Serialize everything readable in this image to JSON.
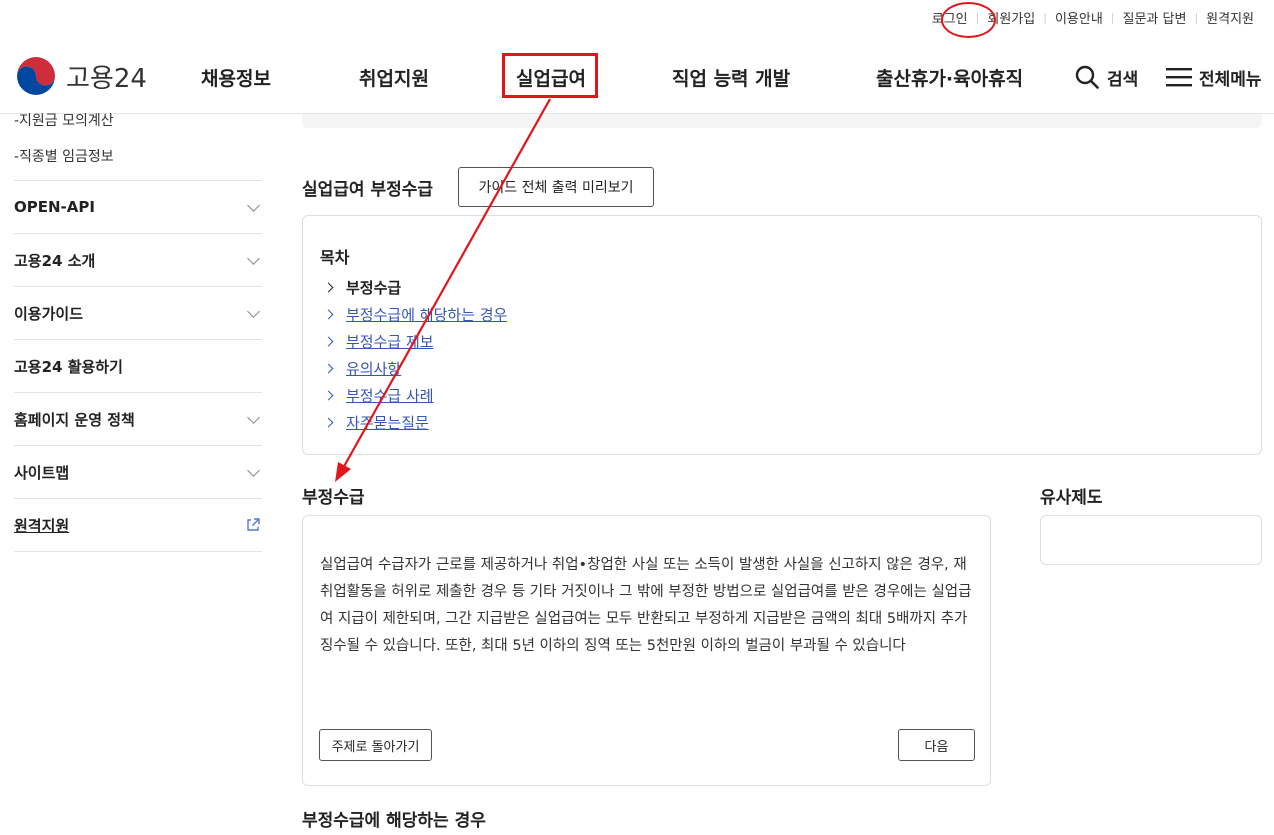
{
  "utility_nav": [
    "로그인",
    "회원가입",
    "이용안내",
    "질문과 답변",
    "원격지원"
  ],
  "logo": {
    "text": "고용24"
  },
  "gnb": [
    "채용정보",
    "취업지원",
    "실업급여",
    "직업 능력 개발",
    "출산휴가·육아휴직"
  ],
  "header_right": {
    "search": "검색",
    "menu": "전체메뉴"
  },
  "sidebar": {
    "sub_links": [
      "-지원금 모의계산",
      "-직종별 임금정보"
    ],
    "items": [
      {
        "label": "OPEN-API"
      },
      {
        "label": "고용24 소개"
      },
      {
        "label": "이용가이드"
      },
      {
        "label": "고용24 활용하기"
      },
      {
        "label": "홈페이지 운영 정책"
      },
      {
        "label": "사이트맵"
      },
      {
        "label": "원격지원"
      }
    ]
  },
  "main": {
    "page_title": "실업급여 부정수급",
    "print_button": "가이드 전체 출력 미리보기",
    "toc": {
      "title": "목차",
      "items": [
        "부정수급",
        "부정수급에 해당하는 경우",
        "부정수급 제보",
        "유의사항",
        "부정수급 사례",
        "자주묻는질문"
      ]
    },
    "section1_title": "부정수급",
    "section1_text": "실업급여 수급자가 근로를 제공하거나 취업•창업한 사실 또는 소득이 발생한 사실을 신고하지 않은 경우, 재취업활동을 허위로 제출한 경우 등 기타 거짓이나 그 밖에 부정한 방법으로 실업급여를 받은 경우에는 실업급여 지급이 제한되며, 그간 지급받은 실업급여는 모두 반환되고 부정하게 지급받은 금액의 최대 5배까지 추가 징수될 수 있습니다. 또한, 최대 5년 이하의 징역 또는 5천만원 이하의 벌금이 부과될 수 있습니다",
    "back_button": "주제로 돌아가기",
    "next_button": "다음",
    "similar_title": "유사제도",
    "section2_title": "부정수급에 해당하는 경우"
  },
  "annotation_color": "#e0161b"
}
